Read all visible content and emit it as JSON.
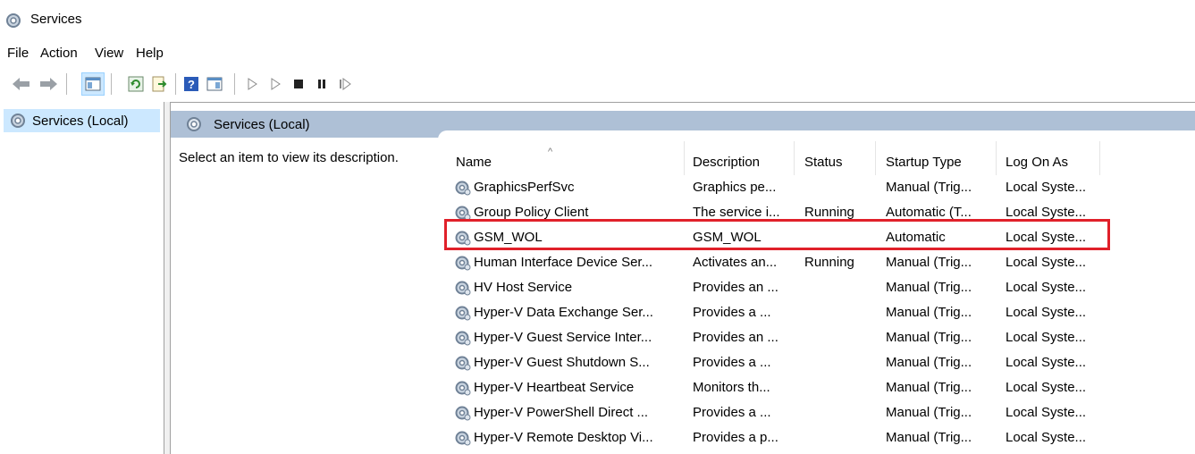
{
  "window": {
    "title": "Services"
  },
  "menu": [
    "File",
    "Action",
    "View",
    "Help"
  ],
  "toolbar": {
    "icons": [
      "back-arrow-icon",
      "forward-arrow-icon",
      "show-hide-console-tree-icon",
      "refresh-icon",
      "export-list-icon",
      "help-icon",
      "properties-icon",
      "start-service-icon",
      "start-service-alt-icon",
      "stop-service-icon",
      "pause-service-icon",
      "restart-service-icon"
    ]
  },
  "tree": {
    "selected_label": "Services (Local)"
  },
  "right": {
    "header_label": "Services (Local)",
    "description_prompt": "Select an item to view its description."
  },
  "table": {
    "columns": [
      "Name",
      "Description",
      "Status",
      "Startup Type",
      "Log On As"
    ],
    "rows": [
      {
        "name": "GraphicsPerfSvc",
        "description": "Graphics pe...",
        "status": "",
        "startup": "Manual (Trig...",
        "logon": "Local Syste..."
      },
      {
        "name": "Group Policy Client",
        "description": "The service i...",
        "status": "Running",
        "startup": "Automatic (T...",
        "logon": "Local Syste..."
      },
      {
        "name": "GSM_WOL",
        "description": "GSM_WOL",
        "status": "",
        "startup": "Automatic",
        "logon": "Local Syste..."
      },
      {
        "name": "Human Interface Device Ser...",
        "description": "Activates an...",
        "status": "Running",
        "startup": "Manual (Trig...",
        "logon": "Local Syste..."
      },
      {
        "name": "HV Host Service",
        "description": "Provides an ...",
        "status": "",
        "startup": "Manual (Trig...",
        "logon": "Local Syste..."
      },
      {
        "name": "Hyper-V Data Exchange Ser...",
        "description": "Provides a ...",
        "status": "",
        "startup": "Manual (Trig...",
        "logon": "Local Syste..."
      },
      {
        "name": "Hyper-V Guest Service Inter...",
        "description": "Provides an ...",
        "status": "",
        "startup": "Manual (Trig...",
        "logon": "Local Syste..."
      },
      {
        "name": "Hyper-V Guest Shutdown S...",
        "description": "Provides a ...",
        "status": "",
        "startup": "Manual (Trig...",
        "logon": "Local Syste..."
      },
      {
        "name": "Hyper-V Heartbeat Service",
        "description": "Monitors th...",
        "status": "",
        "startup": "Manual (Trig...",
        "logon": "Local Syste..."
      },
      {
        "name": "Hyper-V PowerShell Direct ...",
        "description": "Provides a ...",
        "status": "",
        "startup": "Manual (Trig...",
        "logon": "Local Syste..."
      },
      {
        "name": "Hyper-V Remote Desktop Vi...",
        "description": "Provides a p...",
        "status": "",
        "startup": "Manual (Trig...",
        "logon": "Local Syste..."
      }
    ],
    "highlighted_row": "GSM_WOL"
  },
  "colors": {
    "header_bar": "#aec0d6",
    "selection": "#cce8ff",
    "highlight_box": "#e0202a"
  }
}
